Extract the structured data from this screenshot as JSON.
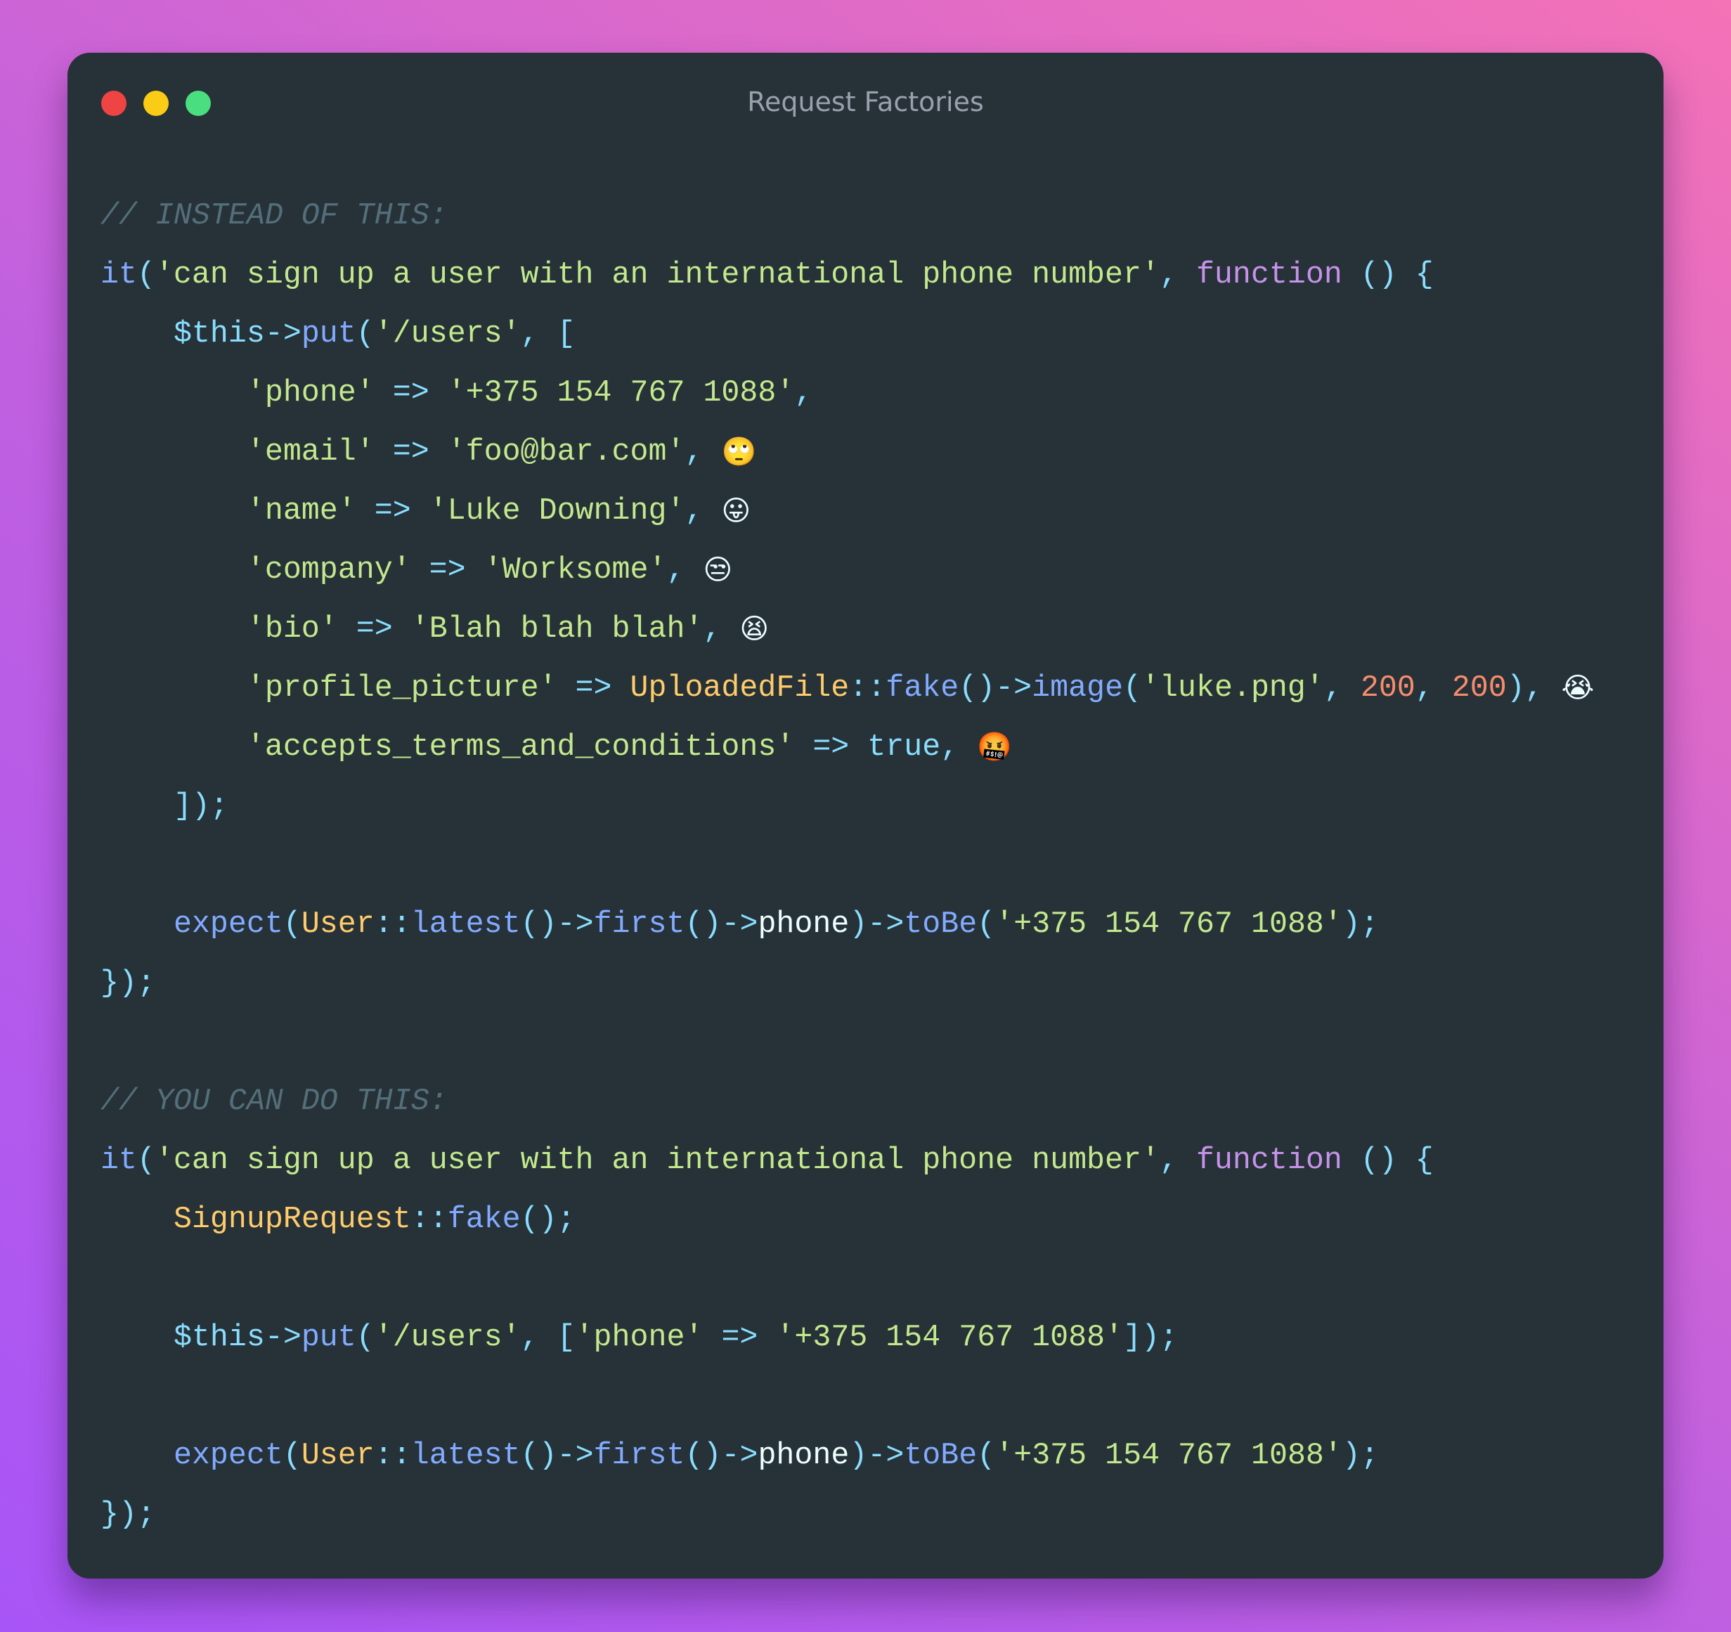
{
  "window": {
    "title": "Request Factories",
    "controls": [
      {
        "name": "close",
        "color": "#ef4444"
      },
      {
        "name": "minimize",
        "color": "#facc15"
      },
      {
        "name": "maximize",
        "color": "#4ade80"
      }
    ]
  },
  "theme": {
    "background": "#263238",
    "gradient_start": "#a855f7",
    "gradient_end": "#f472b6"
  },
  "code": {
    "language": "php",
    "lines": [
      [
        {
          "t": "comment",
          "v": "// INSTEAD OF THIS:"
        }
      ],
      [
        {
          "t": "fn",
          "v": "it"
        },
        {
          "t": "punc",
          "v": "("
        },
        {
          "t": "str",
          "v": "'can sign up a user with an international phone number'"
        },
        {
          "t": "punc",
          "v": ", "
        },
        {
          "t": "kw",
          "v": "function"
        },
        {
          "t": "punc",
          "v": " () {"
        }
      ],
      [
        {
          "t": "plain",
          "v": "    "
        },
        {
          "t": "var",
          "v": "$this"
        },
        {
          "t": "punc",
          "v": "->"
        },
        {
          "t": "fn",
          "v": "put"
        },
        {
          "t": "punc",
          "v": "("
        },
        {
          "t": "str",
          "v": "'/users'"
        },
        {
          "t": "punc",
          "v": ", ["
        }
      ],
      [
        {
          "t": "plain",
          "v": "        "
        },
        {
          "t": "str",
          "v": "'phone'"
        },
        {
          "t": "punc",
          "v": " => "
        },
        {
          "t": "str",
          "v": "'+375 154 767 1088'"
        },
        {
          "t": "punc",
          "v": ","
        }
      ],
      [
        {
          "t": "plain",
          "v": "        "
        },
        {
          "t": "str",
          "v": "'email'"
        },
        {
          "t": "punc",
          "v": " => "
        },
        {
          "t": "str",
          "v": "'foo@bar.com'"
        },
        {
          "t": "punc",
          "v": ", "
        },
        {
          "t": "emoji",
          "v": "🙄",
          "name": "face-with-rolling-eyes-emoji"
        }
      ],
      [
        {
          "t": "plain",
          "v": "        "
        },
        {
          "t": "str",
          "v": "'name'"
        },
        {
          "t": "punc",
          "v": " => "
        },
        {
          "t": "str",
          "v": "'Luke Downing'"
        },
        {
          "t": "punc",
          "v": ", "
        },
        {
          "t": "emoji",
          "v": "😛",
          "name": "face-with-tongue-emoji"
        }
      ],
      [
        {
          "t": "plain",
          "v": "        "
        },
        {
          "t": "str",
          "v": "'company'"
        },
        {
          "t": "punc",
          "v": " => "
        },
        {
          "t": "str",
          "v": "'Worksome'"
        },
        {
          "t": "punc",
          "v": ", "
        },
        {
          "t": "emoji",
          "v": "😒",
          "name": "unamused-face-emoji"
        }
      ],
      [
        {
          "t": "plain",
          "v": "        "
        },
        {
          "t": "str",
          "v": "'bio'"
        },
        {
          "t": "punc",
          "v": " => "
        },
        {
          "t": "str",
          "v": "'Blah blah blah'"
        },
        {
          "t": "punc",
          "v": ", "
        },
        {
          "t": "emoji",
          "v": "😫",
          "name": "tired-face-emoji"
        }
      ],
      [
        {
          "t": "plain",
          "v": "        "
        },
        {
          "t": "str",
          "v": "'profile_picture'"
        },
        {
          "t": "punc",
          "v": " => "
        },
        {
          "t": "cls",
          "v": "UploadedFile"
        },
        {
          "t": "punc",
          "v": "::"
        },
        {
          "t": "fn",
          "v": "fake"
        },
        {
          "t": "punc",
          "v": "()->"
        },
        {
          "t": "fn",
          "v": "image"
        },
        {
          "t": "punc",
          "v": "("
        },
        {
          "t": "str",
          "v": "'luke.png'"
        },
        {
          "t": "punc",
          "v": ", "
        },
        {
          "t": "num",
          "v": "200"
        },
        {
          "t": "punc",
          "v": ", "
        },
        {
          "t": "num",
          "v": "200"
        },
        {
          "t": "punc",
          "v": "), "
        },
        {
          "t": "emoji",
          "v": "😭",
          "name": "loudly-crying-face-emoji"
        }
      ],
      [
        {
          "t": "plain",
          "v": "        "
        },
        {
          "t": "str",
          "v": "'accepts_terms_and_conditions'"
        },
        {
          "t": "punc",
          "v": " => "
        },
        {
          "t": "bool",
          "v": "true"
        },
        {
          "t": "punc",
          "v": ", "
        },
        {
          "t": "emoji",
          "v": "🤬",
          "name": "face-with-symbols-on-mouth-emoji"
        }
      ],
      [
        {
          "t": "plain",
          "v": "    "
        },
        {
          "t": "punc",
          "v": "]);"
        }
      ],
      [],
      [
        {
          "t": "plain",
          "v": "    "
        },
        {
          "t": "fn",
          "v": "expect"
        },
        {
          "t": "punc",
          "v": "("
        },
        {
          "t": "cls",
          "v": "User"
        },
        {
          "t": "punc",
          "v": "::"
        },
        {
          "t": "fn",
          "v": "latest"
        },
        {
          "t": "punc",
          "v": "()->"
        },
        {
          "t": "fn",
          "v": "first"
        },
        {
          "t": "punc",
          "v": "()->"
        },
        {
          "t": "prop",
          "v": "phone"
        },
        {
          "t": "punc",
          "v": ")->"
        },
        {
          "t": "fn",
          "v": "toBe"
        },
        {
          "t": "punc",
          "v": "("
        },
        {
          "t": "str",
          "v": "'+375 154 767 1088'"
        },
        {
          "t": "punc",
          "v": ");"
        }
      ],
      [
        {
          "t": "punc",
          "v": "});"
        }
      ],
      [],
      [
        {
          "t": "comment",
          "v": "// YOU CAN DO THIS:"
        }
      ],
      [
        {
          "t": "fn",
          "v": "it"
        },
        {
          "t": "punc",
          "v": "("
        },
        {
          "t": "str",
          "v": "'can sign up a user with an international phone number'"
        },
        {
          "t": "punc",
          "v": ", "
        },
        {
          "t": "kw",
          "v": "function"
        },
        {
          "t": "punc",
          "v": " () {"
        }
      ],
      [
        {
          "t": "plain",
          "v": "    "
        },
        {
          "t": "cls",
          "v": "SignupRequest"
        },
        {
          "t": "punc",
          "v": "::"
        },
        {
          "t": "fn",
          "v": "fake"
        },
        {
          "t": "punc",
          "v": "();"
        }
      ],
      [],
      [
        {
          "t": "plain",
          "v": "    "
        },
        {
          "t": "var",
          "v": "$this"
        },
        {
          "t": "punc",
          "v": "->"
        },
        {
          "t": "fn",
          "v": "put"
        },
        {
          "t": "punc",
          "v": "("
        },
        {
          "t": "str",
          "v": "'/users'"
        },
        {
          "t": "punc",
          "v": ", ["
        },
        {
          "t": "str",
          "v": "'phone'"
        },
        {
          "t": "punc",
          "v": " => "
        },
        {
          "t": "str",
          "v": "'+375 154 767 1088'"
        },
        {
          "t": "punc",
          "v": "]);"
        }
      ],
      [],
      [
        {
          "t": "plain",
          "v": "    "
        },
        {
          "t": "fn",
          "v": "expect"
        },
        {
          "t": "punc",
          "v": "("
        },
        {
          "t": "cls",
          "v": "User"
        },
        {
          "t": "punc",
          "v": "::"
        },
        {
          "t": "fn",
          "v": "latest"
        },
        {
          "t": "punc",
          "v": "()->"
        },
        {
          "t": "fn",
          "v": "first"
        },
        {
          "t": "punc",
          "v": "()->"
        },
        {
          "t": "prop",
          "v": "phone"
        },
        {
          "t": "punc",
          "v": ")->"
        },
        {
          "t": "fn",
          "v": "toBe"
        },
        {
          "t": "punc",
          "v": "("
        },
        {
          "t": "str",
          "v": "'+375 154 767 1088'"
        },
        {
          "t": "punc",
          "v": ");"
        }
      ],
      [
        {
          "t": "punc",
          "v": "});"
        }
      ]
    ]
  }
}
